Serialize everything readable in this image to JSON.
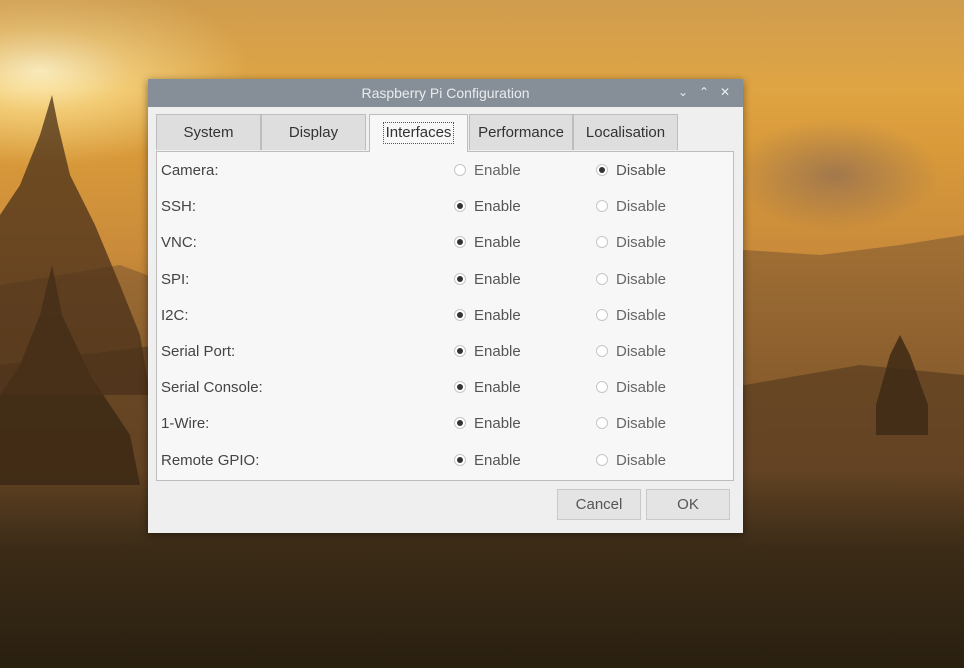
{
  "window": {
    "title": "Raspberry Pi Configuration",
    "controls": {
      "minimize": "⌄",
      "maximize": "⌃",
      "close": "✕"
    }
  },
  "tabs": [
    {
      "label": "System",
      "active": false
    },
    {
      "label": "Display",
      "active": false
    },
    {
      "label": "Interfaces",
      "active": true
    },
    {
      "label": "Performance",
      "active": false
    },
    {
      "label": "Localisation",
      "active": false
    }
  ],
  "options": {
    "enable_label": "Enable",
    "disable_label": "Disable"
  },
  "interfaces": [
    {
      "label": "Camera:",
      "enabled": false
    },
    {
      "label": "SSH:",
      "enabled": true
    },
    {
      "label": "VNC:",
      "enabled": true
    },
    {
      "label": "SPI:",
      "enabled": true
    },
    {
      "label": "I2C:",
      "enabled": true
    },
    {
      "label": "Serial Port:",
      "enabled": true
    },
    {
      "label": "Serial Console:",
      "enabled": true
    },
    {
      "label": "1-Wire:",
      "enabled": true
    },
    {
      "label": "Remote GPIO:",
      "enabled": true
    }
  ],
  "buttons": {
    "cancel": "Cancel",
    "ok": "OK"
  },
  "colors": {
    "titlebar": "#868f98",
    "dialog": "#efefef",
    "panel": "#f7f7f7"
  }
}
